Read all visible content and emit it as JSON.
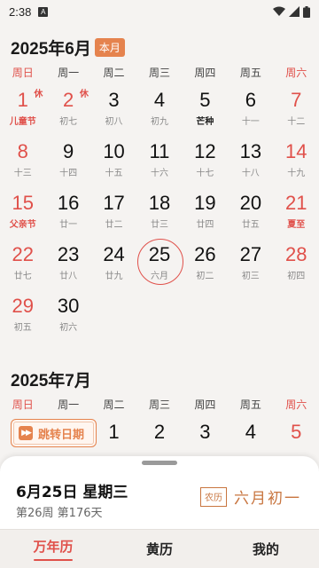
{
  "status_bar": {
    "time": "2:38",
    "notification_letter": "A"
  },
  "weekday_labels": [
    "周日",
    "周一",
    "周二",
    "周三",
    "周四",
    "周五",
    "周六"
  ],
  "months": [
    {
      "title": "2025年6月",
      "badge": "本月",
      "weeks": [
        [
          {
            "num": "1",
            "lunar": "儿童节",
            "red": true,
            "lunar_style": "red",
            "rest": "休"
          },
          {
            "num": "2",
            "lunar": "初七",
            "red": true,
            "lunar_style": "",
            "rest": "休"
          },
          {
            "num": "3",
            "lunar": "初八"
          },
          {
            "num": "4",
            "lunar": "初九"
          },
          {
            "num": "5",
            "lunar": "芒种",
            "lunar_style": "term"
          },
          {
            "num": "6",
            "lunar": "十一"
          },
          {
            "num": "7",
            "lunar": "十二",
            "red": true
          }
        ],
        [
          {
            "num": "8",
            "lunar": "十三",
            "red": true
          },
          {
            "num": "9",
            "lunar": "十四"
          },
          {
            "num": "10",
            "lunar": "十五"
          },
          {
            "num": "11",
            "lunar": "十六"
          },
          {
            "num": "12",
            "lunar": "十七"
          },
          {
            "num": "13",
            "lunar": "十八"
          },
          {
            "num": "14",
            "lunar": "十九",
            "red": true
          }
        ],
        [
          {
            "num": "15",
            "lunar": "父亲节",
            "red": true,
            "lunar_style": "red"
          },
          {
            "num": "16",
            "lunar": "廿一"
          },
          {
            "num": "17",
            "lunar": "廿二"
          },
          {
            "num": "18",
            "lunar": "廿三"
          },
          {
            "num": "19",
            "lunar": "廿四"
          },
          {
            "num": "20",
            "lunar": "廿五"
          },
          {
            "num": "21",
            "lunar": "夏至",
            "red": true,
            "lunar_style": "red"
          }
        ],
        [
          {
            "num": "22",
            "lunar": "廿七",
            "red": true
          },
          {
            "num": "23",
            "lunar": "廿八"
          },
          {
            "num": "24",
            "lunar": "廿九"
          },
          {
            "num": "25",
            "lunar": "六月",
            "selected": true
          },
          {
            "num": "26",
            "lunar": "初二"
          },
          {
            "num": "27",
            "lunar": "初三"
          },
          {
            "num": "28",
            "lunar": "初四",
            "red": true
          }
        ],
        [
          {
            "num": "29",
            "lunar": "初五",
            "red": true
          },
          {
            "num": "30",
            "lunar": "初六"
          },
          null,
          null,
          null,
          null,
          null
        ]
      ]
    },
    {
      "title": "2025年7月",
      "badge": "",
      "weeks": [
        [
          null,
          null,
          {
            "num": "1",
            "lunar": ""
          },
          {
            "num": "2",
            "lunar": ""
          },
          {
            "num": "3",
            "lunar": ""
          },
          {
            "num": "4",
            "lunar": ""
          },
          {
            "num": "5",
            "lunar": "",
            "red": true
          }
        ]
      ]
    }
  ],
  "jump_button": {
    "icon": "fast-forward-icon",
    "label": "跳转日期"
  },
  "detail_sheet": {
    "date": "6月25日 星期三",
    "week_info": "第26周 第176天",
    "lunar_stamp": "农历",
    "lunar_date": "六月初一"
  },
  "tabs": [
    {
      "label": "万年历",
      "active": true
    },
    {
      "label": "黄历",
      "active": false
    },
    {
      "label": "我的",
      "active": false
    }
  ],
  "colors": {
    "accent_red": "#e0504a",
    "accent_orange": "#e5834e",
    "lunar_brown": "#c8753f"
  }
}
